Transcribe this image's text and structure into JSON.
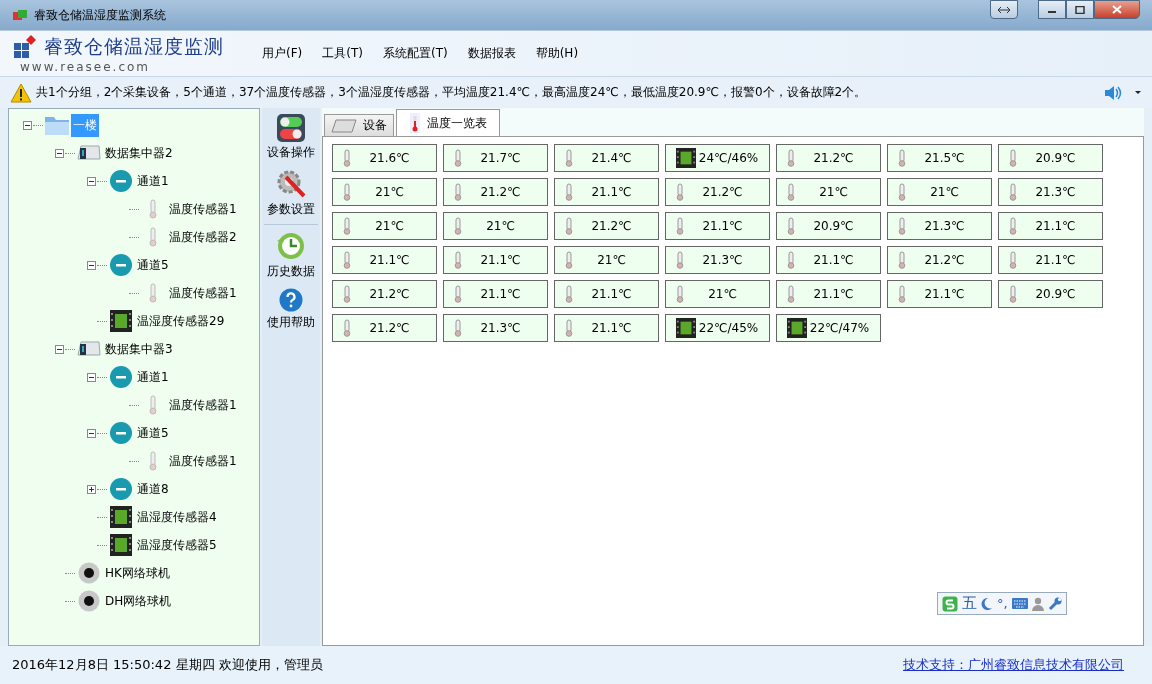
{
  "window": {
    "title": "睿致仓储温湿度监测系统"
  },
  "header": {
    "logo_text": "睿致仓储温湿度监测",
    "logo_url": "www.reasee.com"
  },
  "menu": [
    "用户(F)",
    "工具(T)",
    "系统配置(T)",
    "数据报表",
    "帮助(H)"
  ],
  "alert": {
    "text": "共1个分组，2个采集设备，5个通道，37个温度传感器，3个温湿度传感器，平均温度21.4℃，最高温度24℃，最低温度20.9℃，报警0个，设备故障2个。"
  },
  "tree": [
    {
      "label": "一楼",
      "kind": "folder",
      "selected": true,
      "expanded": true,
      "children": [
        {
          "label": "数据集中器2",
          "kind": "hub",
          "selected": false,
          "expanded": true,
          "children": [
            {
              "label": "通道1",
              "kind": "channel",
              "selected": false,
              "expanded": true,
              "children": [
                {
                  "label": "温度传感器1",
                  "kind": "sensor",
                  "selected": false
                },
                {
                  "label": "温度传感器2",
                  "kind": "sensor",
                  "selected": false
                }
              ]
            },
            {
              "label": "通道5",
              "kind": "channel",
              "selected": false,
              "expanded": true,
              "children": [
                {
                  "label": "温度传感器1",
                  "kind": "sensor",
                  "selected": false
                }
              ]
            },
            {
              "label": "温湿度传感器29",
              "kind": "thsensor",
              "selected": false
            }
          ]
        },
        {
          "label": "数据集中器3",
          "kind": "hub",
          "selected": false,
          "expanded": true,
          "children": [
            {
              "label": "通道1",
              "kind": "channel",
              "selected": false,
              "expanded": true,
              "children": [
                {
                  "label": "温度传感器1",
                  "kind": "sensor",
                  "selected": false
                }
              ]
            },
            {
              "label": "通道5",
              "kind": "channel",
              "selected": false,
              "expanded": true,
              "children": [
                {
                  "label": "温度传感器1",
                  "kind": "sensor",
                  "selected": false
                }
              ]
            },
            {
              "label": "通道8",
              "kind": "channel",
              "selected": false,
              "expanded": false
            },
            {
              "label": "温湿度传感器4",
              "kind": "thsensor",
              "selected": false
            },
            {
              "label": "温湿度传感器5",
              "kind": "thsensor",
              "selected": false
            }
          ]
        },
        {
          "label": "HK网络球机",
          "kind": "camera",
          "selected": false
        },
        {
          "label": "DH网络球机",
          "kind": "camera",
          "selected": false
        }
      ]
    }
  ],
  "toolbar": [
    {
      "label": "设备操作",
      "kind": "switch"
    },
    {
      "label": "参数设置",
      "kind": "tools"
    },
    {
      "label": "历史数据",
      "kind": "history"
    },
    {
      "label": "使用帮助",
      "kind": "help"
    }
  ],
  "tabs": [
    {
      "label": "设备",
      "kind": "device",
      "selected": false
    },
    {
      "label": "温度一览表",
      "kind": "thermo",
      "selected": true
    }
  ],
  "cells": [
    {
      "kind": "temp",
      "value": "21.6℃"
    },
    {
      "kind": "temp",
      "value": "21.7℃"
    },
    {
      "kind": "temp",
      "value": "21.4℃"
    },
    {
      "kind": "th",
      "value": "24℃/46%"
    },
    {
      "kind": "temp",
      "value": "21.2℃"
    },
    {
      "kind": "temp",
      "value": "21.5℃"
    },
    {
      "kind": "temp",
      "value": "20.9℃"
    },
    {
      "kind": "temp",
      "value": "21℃"
    },
    {
      "kind": "temp",
      "value": "21.2℃"
    },
    {
      "kind": "temp",
      "value": "21.1℃"
    },
    {
      "kind": "temp",
      "value": "21.2℃"
    },
    {
      "kind": "temp",
      "value": "21℃"
    },
    {
      "kind": "temp",
      "value": "21℃"
    },
    {
      "kind": "temp",
      "value": "21.3℃"
    },
    {
      "kind": "temp",
      "value": "21℃"
    },
    {
      "kind": "temp",
      "value": "21℃"
    },
    {
      "kind": "temp",
      "value": "21.2℃"
    },
    {
      "kind": "temp",
      "value": "21.1℃"
    },
    {
      "kind": "temp",
      "value": "20.9℃"
    },
    {
      "kind": "temp",
      "value": "21.3℃"
    },
    {
      "kind": "temp",
      "value": "21.1℃"
    },
    {
      "kind": "temp",
      "value": "21.1℃"
    },
    {
      "kind": "temp",
      "value": "21.1℃"
    },
    {
      "kind": "temp",
      "value": "21℃"
    },
    {
      "kind": "temp",
      "value": "21.3℃"
    },
    {
      "kind": "temp",
      "value": "21.1℃"
    },
    {
      "kind": "temp",
      "value": "21.2℃"
    },
    {
      "kind": "temp",
      "value": "21.1℃"
    },
    {
      "kind": "temp",
      "value": "21.2℃"
    },
    {
      "kind": "temp",
      "value": "21.1℃"
    },
    {
      "kind": "temp",
      "value": "21.1℃"
    },
    {
      "kind": "temp",
      "value": "21℃"
    },
    {
      "kind": "temp",
      "value": "21.1℃"
    },
    {
      "kind": "temp",
      "value": "21.1℃"
    },
    {
      "kind": "temp",
      "value": "20.9℃"
    },
    {
      "kind": "temp",
      "value": "21.2℃"
    },
    {
      "kind": "temp",
      "value": "21.3℃"
    },
    {
      "kind": "temp",
      "value": "21.1℃"
    },
    {
      "kind": "th",
      "value": "22℃/45%"
    },
    {
      "kind": "th",
      "value": "22℃/47%"
    }
  ],
  "ime": {
    "mode": "五",
    "punct": "°,"
  },
  "status": {
    "text": "2016年12月8日 15:50:42 星期四  欢迎使用，管理员",
    "link": "技术支持：广州睿致信息技术有限公司"
  }
}
